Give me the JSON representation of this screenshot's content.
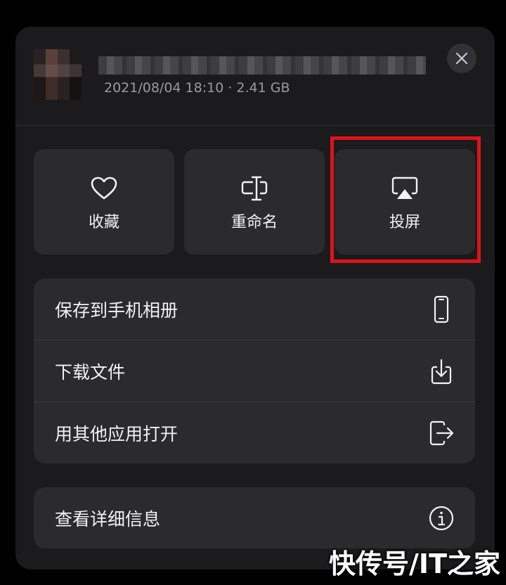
{
  "file": {
    "meta": "2021/08/04 18:10 · 2.41 GB"
  },
  "actions": [
    {
      "label": "收藏",
      "icon": "heart-icon"
    },
    {
      "label": "重命名",
      "icon": "rename-cursor-icon"
    },
    {
      "label": "投屏",
      "icon": "airplay-icon"
    }
  ],
  "menu_group_1": [
    {
      "label": "保存到手机相册",
      "icon": "phone-icon"
    },
    {
      "label": "下载文件",
      "icon": "download-icon"
    },
    {
      "label": "用其他应用打开",
      "icon": "open-in-app-icon"
    }
  ],
  "menu_group_2": [
    {
      "label": "查看详细信息",
      "icon": "info-icon"
    }
  ],
  "highlight_color": "#e0121a",
  "watermark": "快传号/IT之家"
}
